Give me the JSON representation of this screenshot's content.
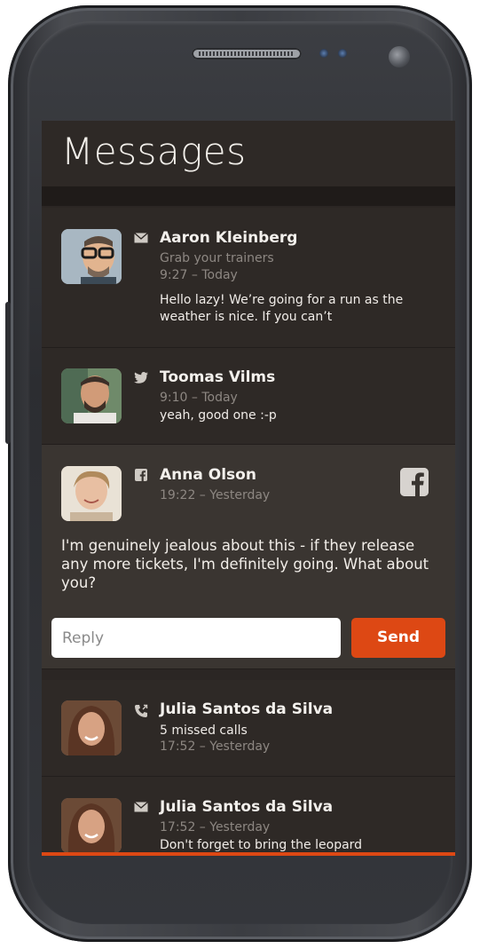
{
  "app": {
    "title": "Messages"
  },
  "messages": [
    {
      "type_icon": "envelope-icon",
      "sender": "Aaron Kleinberg",
      "subject": "Grab your trainers",
      "time": "9:27 – Today",
      "body": "Hello lazy! We’re going for a run as the weather is nice. If you can’t"
    },
    {
      "type_icon": "twitter-icon",
      "sender": "Toomas Vilms",
      "time": "9:10 – Today",
      "body": "yeah, good one :-p"
    },
    {
      "type_icon": "facebook-icon",
      "sender": "Anna Olson",
      "time": "19:22 – Yesterday",
      "body": "I'm genuinely jealous about this - if they release any more tickets, I'm definitely going. What about you?",
      "badge_icon": "facebook-badge-icon",
      "reply_placeholder": "Reply",
      "send_label": "Send"
    },
    {
      "type_icon": "missed-call-icon",
      "sender": "Julia Santos da Silva",
      "detail": "5 missed calls",
      "time": "17:52 – Yesterday"
    },
    {
      "type_icon": "envelope-icon",
      "sender": "Julia Santos da Silva",
      "time": "17:52 – Yesterday",
      "body": "Don't forget to bring the leopard"
    }
  ],
  "colors": {
    "accent": "#dd4814",
    "background": "#2e2926",
    "expanded_background": "#3a3531",
    "text_primary": "#f3f0ec",
    "text_secondary": "#8d8782"
  }
}
